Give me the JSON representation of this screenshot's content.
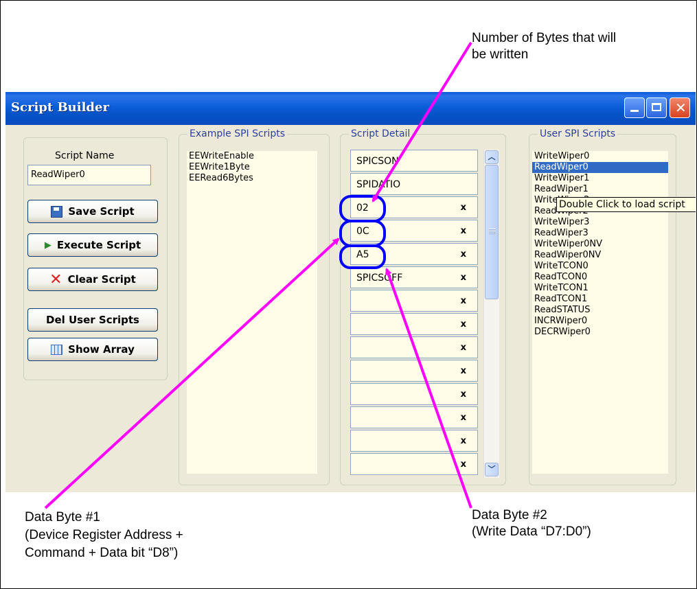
{
  "window": {
    "title": "Script Builder"
  },
  "left_panel": {
    "script_name_label": "Script Name",
    "script_name_value": "ReadWiper0",
    "buttons": {
      "save": "Save Script",
      "execute": "Execute Script",
      "clear": "Clear Script",
      "del_user": "Del User Scripts",
      "show_array": "Show Array"
    }
  },
  "example_scripts": {
    "title": "Example SPI Scripts",
    "items": [
      "EEWriteEnable",
      "EEWrite1Byte",
      "EERead6Bytes"
    ]
  },
  "script_detail": {
    "title": "Script Detail",
    "rows": [
      "SPICSON",
      "SPIDATIO",
      "02",
      "0C",
      "A5",
      "SPICSOFF",
      "",
      "",
      "",
      "",
      "",
      "",
      "",
      ""
    ],
    "delete_glyph": "x"
  },
  "user_scripts": {
    "title": "User SPI Scripts",
    "items": [
      "WriteWiper0",
      "ReadWiper0",
      "WriteWiper1",
      "ReadWiper1",
      "WriteWiper2",
      "ReadWiper2",
      "WriteWiper3",
      "ReadWiper3",
      "WriteWiper0NV",
      "ReadWiper0NV",
      "WriteTCON0",
      "ReadTCON0",
      "WriteTCON1",
      "ReadTCON1",
      "ReadSTATUS",
      "INCRWiper0",
      "DECRWiper0"
    ],
    "selected_index": 1,
    "tooltip": "Double Click to load script"
  },
  "annotations": {
    "top": "Number of Bytes that will\nbe written",
    "data_byte_1": "Data Byte #1\n(Device Register Address +\nCommand + Data bit “D8”)",
    "data_byte_2": "Data Byte #2\n(Write Data “D7:D0”)"
  },
  "colors": {
    "arrow": "#ff00ff",
    "highlight": "#0000ff"
  }
}
